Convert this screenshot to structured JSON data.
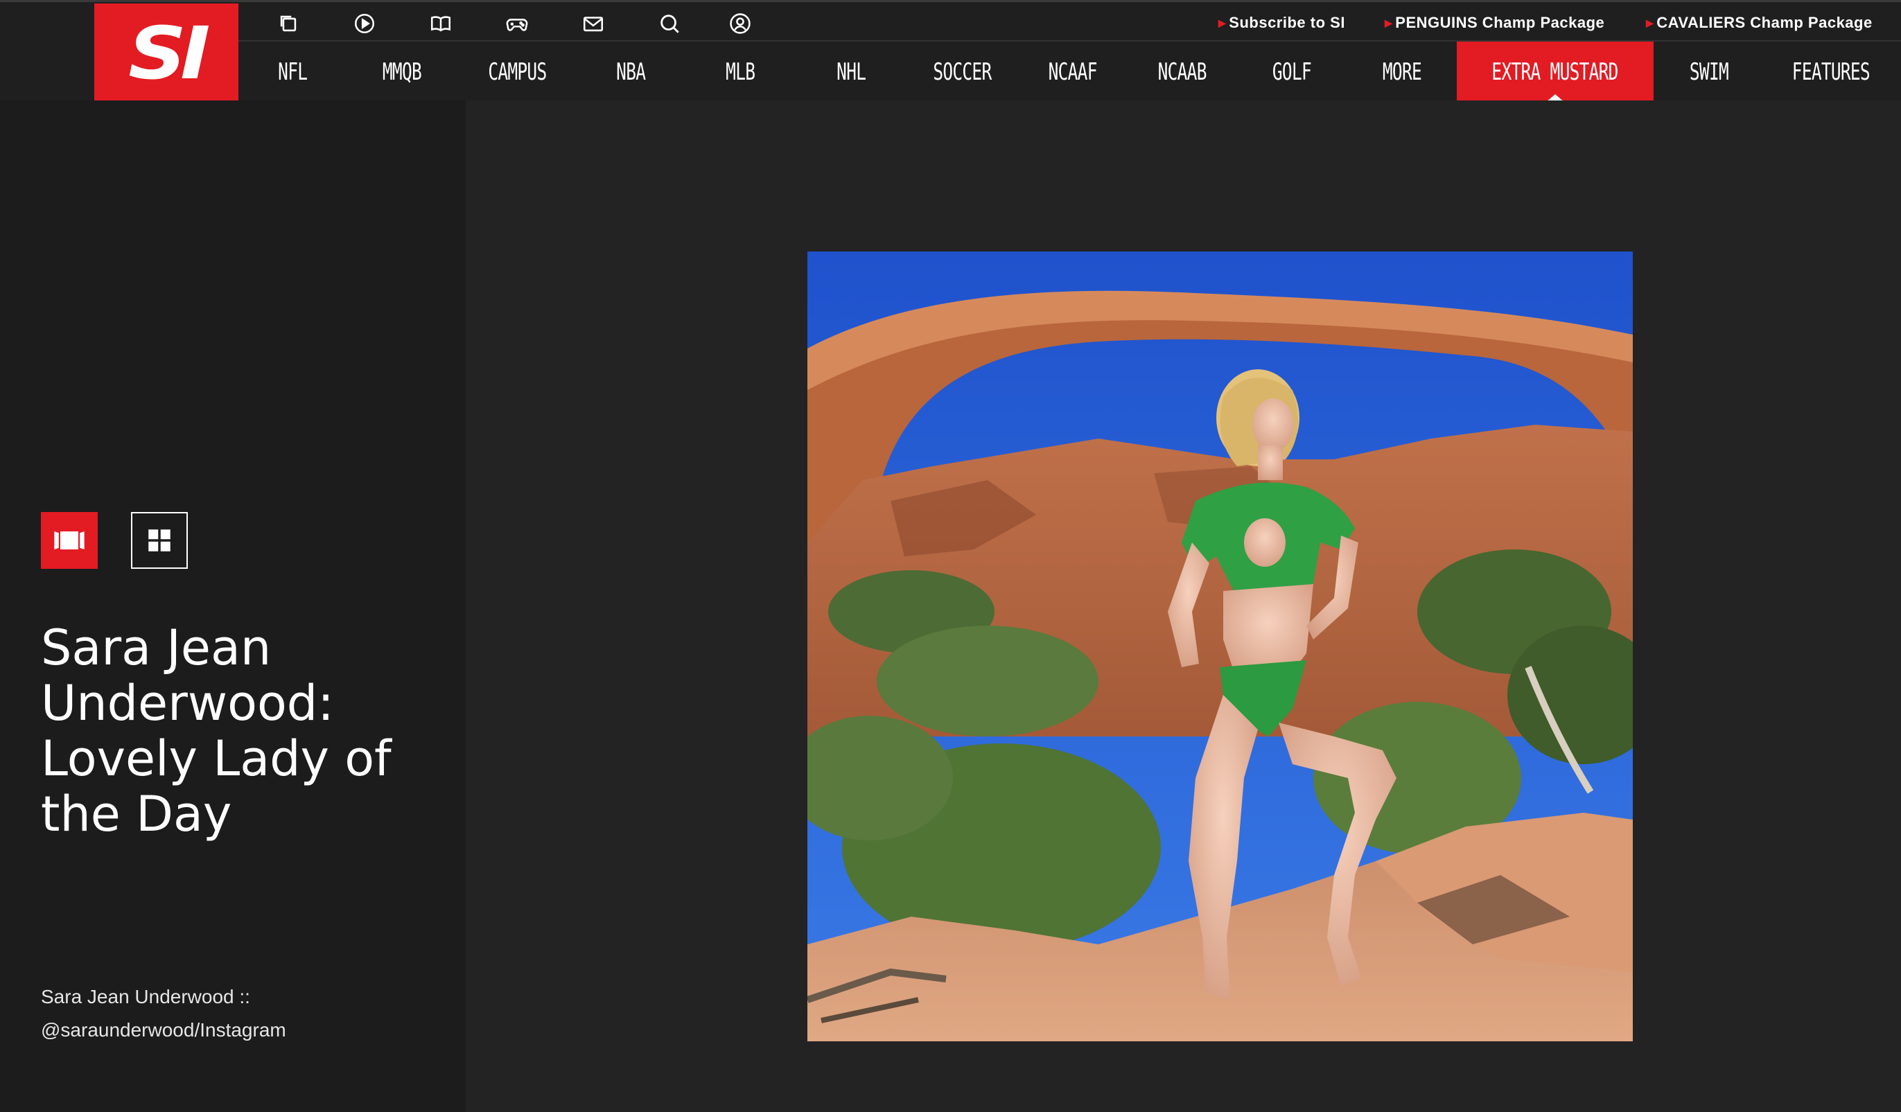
{
  "site": {
    "logo_text": "SI",
    "brand_color": "#e31b23"
  },
  "utility_icons": [
    {
      "name": "gallery-copy-icon"
    },
    {
      "name": "play-video-icon"
    },
    {
      "name": "magazine-icon"
    },
    {
      "name": "gamepad-icon"
    },
    {
      "name": "newsletter-mail-icon"
    },
    {
      "name": "search-icon"
    },
    {
      "name": "user-account-icon"
    }
  ],
  "promos": [
    {
      "label": "Subscribe to SI"
    },
    {
      "label": "PENGUINS Champ Package"
    },
    {
      "label": "CAVALIERS Champ Package"
    }
  ],
  "nav": {
    "items": [
      {
        "label": "NFL"
      },
      {
        "label": "MMQB"
      },
      {
        "label": "CAMPUS"
      },
      {
        "label": "NBA"
      },
      {
        "label": "MLB"
      },
      {
        "label": "NHL"
      },
      {
        "label": "SOCCER"
      },
      {
        "label": "NCAAF"
      },
      {
        "label": "NCAAB"
      },
      {
        "label": "GOLF"
      },
      {
        "label": "MORE"
      },
      {
        "label": "EXTRA MUSTARD"
      },
      {
        "label": "SWIM"
      },
      {
        "label": "FEATURES"
      }
    ],
    "active": "EXTRA MUSTARD"
  },
  "gallery": {
    "view_modes": [
      "filmstrip-view",
      "grid-view"
    ],
    "active_view": "filmstrip-view",
    "title": "Sara Jean Underwood: Lovely Lady of the Day",
    "caption": "Sara Jean Underwood :: @saraunderwood/Instagram"
  }
}
